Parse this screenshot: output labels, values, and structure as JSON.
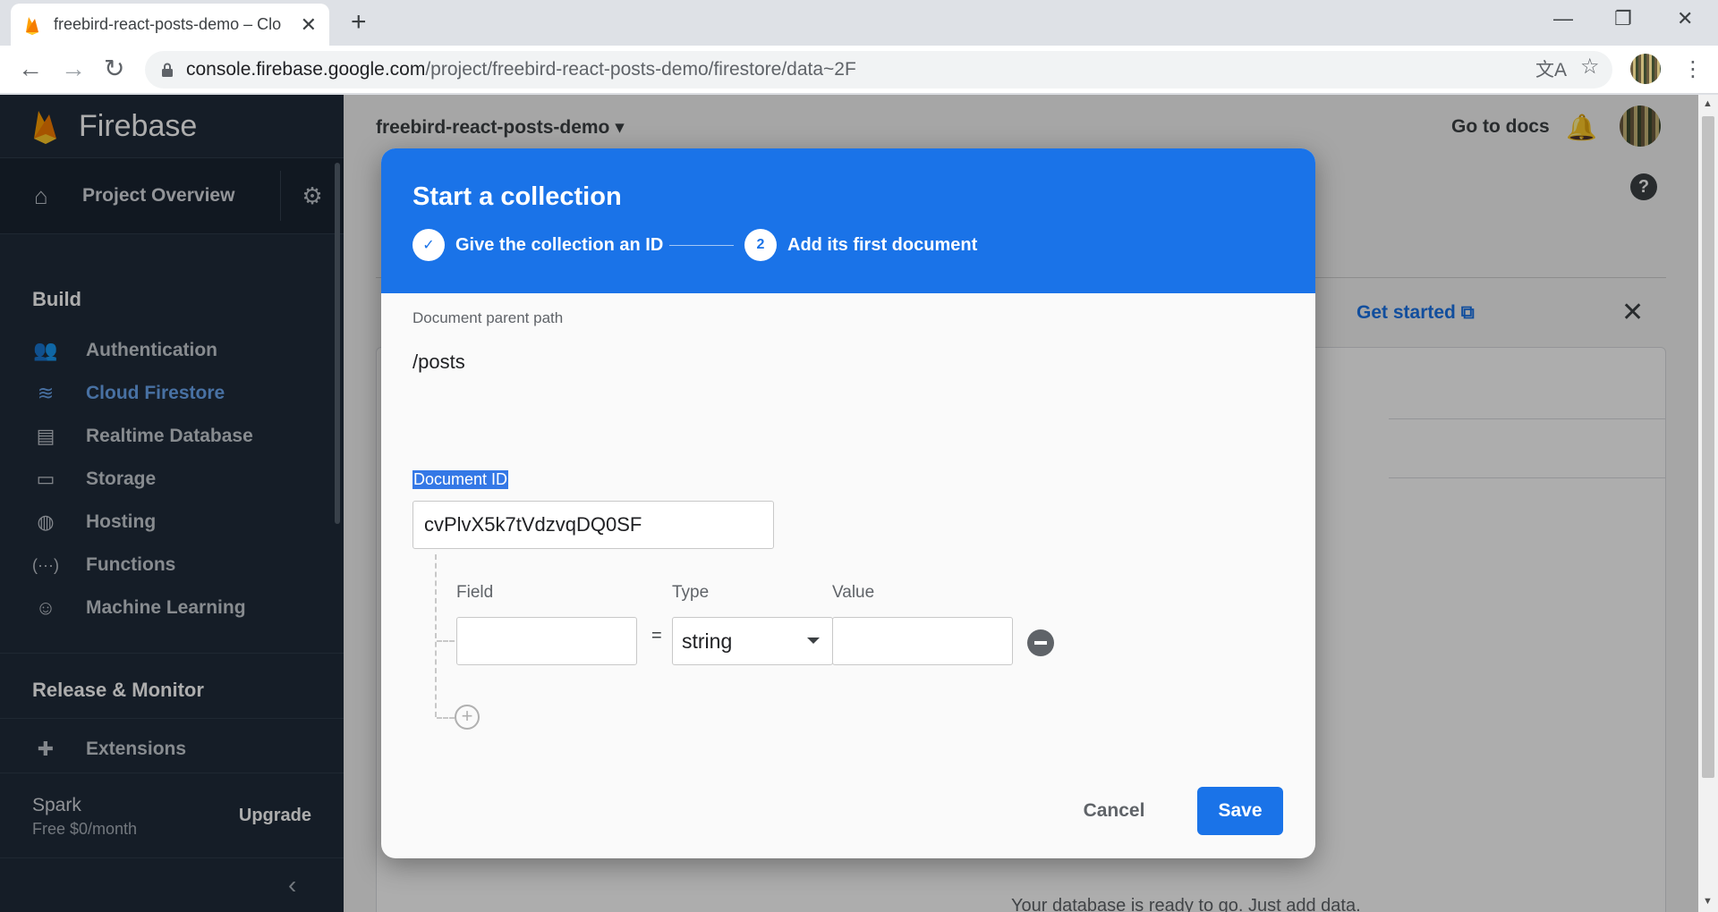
{
  "browser": {
    "tab_title": "freebird-react-posts-demo – Clo",
    "url_host": "console.firebase.google.com",
    "url_path": "/project/freebird-react-posts-demo/firestore/data~2F"
  },
  "sidebar": {
    "brand": "Firebase",
    "project_overview": "Project Overview",
    "build_title": "Build",
    "build_items": [
      {
        "label": "Authentication",
        "icon": "people-icon"
      },
      {
        "label": "Cloud Firestore",
        "icon": "firestore-icon",
        "active": true
      },
      {
        "label": "Realtime Database",
        "icon": "database-icon"
      },
      {
        "label": "Storage",
        "icon": "storage-icon"
      },
      {
        "label": "Hosting",
        "icon": "globe-icon"
      },
      {
        "label": "Functions",
        "icon": "functions-icon"
      },
      {
        "label": "Machine Learning",
        "icon": "robot-icon"
      }
    ],
    "release_title": "Release & Monitor",
    "extensions": "Extensions",
    "plan_name": "Spark",
    "plan_price": "Free $0/month",
    "upgrade": "Upgrade"
  },
  "main": {
    "project_name": "freebird-react-posts-demo",
    "go_to_docs": "Go to docs",
    "get_started": "Get started",
    "ready_text": "Your database is ready to go. Just add data."
  },
  "dialog": {
    "title": "Start a collection",
    "step1_label": "Give the collection an ID",
    "step2_number": "2",
    "step2_label": "Add its first document",
    "parent_path_label": "Document parent path",
    "parent_path": "/posts",
    "doc_id_label": "Document ID",
    "doc_id_value": "cvPlvX5k7tVdzvqDQ0SF",
    "field_col": "Field",
    "type_col": "Type",
    "value_col": "Value",
    "field_value": "",
    "type_value": "string",
    "value_value": "",
    "equals": "=",
    "cancel": "Cancel",
    "save": "Save"
  },
  "colors": {
    "accent": "#1a73e8",
    "sidebar_bg": "#1f2b3a",
    "active_item": "#6ba7f0"
  }
}
